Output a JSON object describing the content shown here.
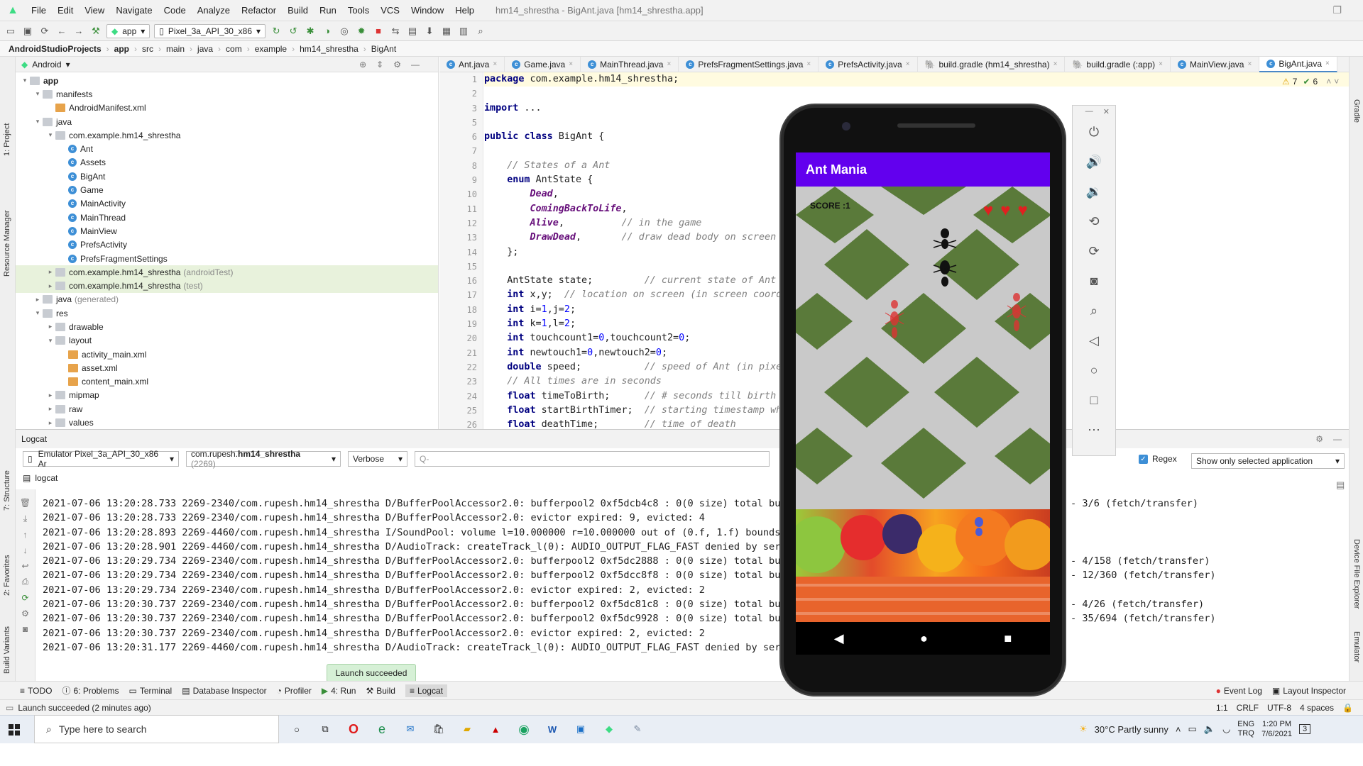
{
  "menu": {
    "items": [
      "File",
      "Edit",
      "View",
      "Navigate",
      "Code",
      "Analyze",
      "Refactor",
      "Build",
      "Run",
      "Tools",
      "VCS",
      "Window",
      "Help"
    ],
    "window_title": "hm14_shrestha - BigAnt.java [hm14_shrestha.app]"
  },
  "toolbar": {
    "run_config": "app",
    "device": "Pixel_3a_API_30_x86"
  },
  "breadcrumbs": [
    "AndroidStudioProjects",
    "app",
    "src",
    "main",
    "java",
    "com",
    "example",
    "hm14_shrestha",
    "BigAnt"
  ],
  "left_strip": {
    "project": "1: Project",
    "resource_manager": "Resource Manager",
    "structure": "7: Structure",
    "favorites": "2: Favorites",
    "build_variants": "Build Variants"
  },
  "project_panel": {
    "view_mode": "Android",
    "tree": [
      {
        "label": "app",
        "indent": 0,
        "arrow": "▾",
        "icon": "folder",
        "bold": true
      },
      {
        "label": "manifests",
        "indent": 1,
        "arrow": "▾",
        "icon": "folder"
      },
      {
        "label": "AndroidManifest.xml",
        "indent": 2,
        "arrow": "",
        "icon": "xml"
      },
      {
        "label": "java",
        "indent": 1,
        "arrow": "▾",
        "icon": "folder"
      },
      {
        "label": "com.example.hm14_shrestha",
        "indent": 2,
        "arrow": "▾",
        "icon": "folder"
      },
      {
        "label": "Ant",
        "indent": 3,
        "arrow": "",
        "icon": "class"
      },
      {
        "label": "Assets",
        "indent": 3,
        "arrow": "",
        "icon": "class"
      },
      {
        "label": "BigAnt",
        "indent": 3,
        "arrow": "",
        "icon": "class"
      },
      {
        "label": "Game",
        "indent": 3,
        "arrow": "",
        "icon": "class"
      },
      {
        "label": "MainActivity",
        "indent": 3,
        "arrow": "",
        "icon": "class"
      },
      {
        "label": "MainThread",
        "indent": 3,
        "arrow": "",
        "icon": "class"
      },
      {
        "label": "MainView",
        "indent": 3,
        "arrow": "",
        "icon": "class"
      },
      {
        "label": "PrefsActivity",
        "indent": 3,
        "arrow": "",
        "icon": "class"
      },
      {
        "label": "PrefsFragmentSettings",
        "indent": 3,
        "arrow": "",
        "icon": "class"
      },
      {
        "label": "com.example.hm14_shrestha",
        "suffix": "(androidTest)",
        "indent": 2,
        "arrow": "▸",
        "icon": "folder",
        "sel": true
      },
      {
        "label": "com.example.hm14_shrestha",
        "suffix": "(test)",
        "indent": 2,
        "arrow": "▸",
        "icon": "folder",
        "sel": true
      },
      {
        "label": "java",
        "suffix": "(generated)",
        "indent": 1,
        "arrow": "▸",
        "icon": "folder"
      },
      {
        "label": "res",
        "indent": 1,
        "arrow": "▾",
        "icon": "folder"
      },
      {
        "label": "drawable",
        "indent": 2,
        "arrow": "▸",
        "icon": "folder"
      },
      {
        "label": "layout",
        "indent": 2,
        "arrow": "▾",
        "icon": "folder"
      },
      {
        "label": "activity_main.xml",
        "indent": 3,
        "arrow": "",
        "icon": "xml"
      },
      {
        "label": "asset.xml",
        "indent": 3,
        "arrow": "",
        "icon": "xml"
      },
      {
        "label": "content_main.xml",
        "indent": 3,
        "arrow": "",
        "icon": "xml"
      },
      {
        "label": "mipmap",
        "indent": 2,
        "arrow": "▸",
        "icon": "folder"
      },
      {
        "label": "raw",
        "indent": 2,
        "arrow": "▸",
        "icon": "folder"
      },
      {
        "label": "values",
        "indent": 2,
        "arrow": "▸",
        "icon": "folder"
      }
    ]
  },
  "editor": {
    "tabs": [
      "Ant.java",
      "Game.java",
      "MainThread.java",
      "PrefsFragmentSettings.java",
      "PrefsActivity.java",
      "build.gradle (hm14_shrestha)",
      "build.gradle (:app)",
      "MainView.java",
      "BigAnt.java"
    ],
    "active_tab": "BigAnt.java",
    "warnings": "7",
    "checks": "6",
    "line_numbers": [
      "1",
      "2",
      "3",
      "5",
      "6",
      "7",
      "8",
      "9",
      "10",
      "11",
      "12",
      "13",
      "14",
      "15",
      "16",
      "17",
      "18",
      "19",
      "20",
      "21",
      "22",
      "23",
      "24",
      "25",
      "26"
    ],
    "lines": [
      "package com.example.hm14_shrestha;",
      "",
      "import ...",
      "",
      "public class BigAnt {",
      "",
      "    // States of a Ant",
      "    enum AntState {",
      "        Dead,",
      "        ComingBackToLife,",
      "        Alive,          // in the game",
      "        DrawDead,       // draw dead body on screen",
      "    };",
      "",
      "    AntState state;         // current state of Ant",
      "    int x,y;  // location on screen (in screen coordinates)",
      "    int i=1,j=2;",
      "    int k=1,l=2;",
      "    int touchcount1=0,touchcount2=0;",
      "    int newtouch1=0,newtouch2=0;",
      "    double speed;           // speed of Ant (in pixels)",
      "    // All times are in seconds",
      "    float timeToBirth;      // # seconds till birth",
      "    float startBirthTimer;  // starting timestamp when",
      "    float deathTime;        // time of death"
    ]
  },
  "logcat": {
    "title": "Logcat",
    "device": "Emulator Pixel_3a_API_30_x86 Ar",
    "process": "com.rupesh.",
    "process_bold": "hm14_shrestha",
    "pid": "(2269)",
    "level": "Verbose",
    "search_placeholder": "Q-",
    "regex_label": "Regex",
    "filter": "Show only selected application",
    "sub_title": "logcat",
    "lines": [
      "2021-07-06 13:20:28.733 2269-2340/com.rupesh.hm14_shrestha D/BufferPoolAccessor2.0: bufferpool2 0xf5dcb4c8 : 0(0 size) total buffe",
      "2021-07-06 13:20:28.733 2269-2340/com.rupesh.hm14_shrestha D/BufferPoolAccessor2.0: evictor expired: 9, evicted: 4",
      "2021-07-06 13:20:28.893 2269-4460/com.rupesh.hm14_shrestha I/SoundPool: volume l=10.000000 r=10.000000 out of (0.f, 1.f) bounds, u",
      "2021-07-06 13:20:28.901 2269-4460/com.rupesh.hm14_shrestha D/AudioTrack: createTrack_l(0): AUDIO_OUTPUT_FLAG_FAST denied by server",
      "2021-07-06 13:20:29.734 2269-2340/com.rupesh.hm14_shrestha D/BufferPoolAccessor2.0: bufferpool2 0xf5dc2888 : 0(0 size) total buffe",
      "2021-07-06 13:20:29.734 2269-2340/com.rupesh.hm14_shrestha D/BufferPoolAccessor2.0: bufferpool2 0xf5dcc8f8 : 0(0 size) total buffe",
      "2021-07-06 13:20:29.734 2269-2340/com.rupesh.hm14_shrestha D/BufferPoolAccessor2.0: evictor expired: 2, evicted: 2",
      "2021-07-06 13:20:30.737 2269-2340/com.rupesh.hm14_shrestha D/BufferPoolAccessor2.0: bufferpool2 0xf5dc81c8 : 0(0 size) total buffe",
      "2021-07-06 13:20:30.737 2269-2340/com.rupesh.hm14_shrestha D/BufferPoolAccessor2.0: bufferpool2 0xf5dc9928 : 0(0 size) total buffe",
      "2021-07-06 13:20:30.737 2269-2340/com.rupesh.hm14_shrestha D/BufferPoolAccessor2.0: evictor expired: 2, evicted: 2",
      "2021-07-06 13:20:31.177 2269-4460/com.rupesh.hm14_shrestha D/AudioTrack: createTrack_l(0): AUDIO_OUTPUT_FLAG_FAST denied by server"
    ],
    "tails": [
      "- 3/6 (fetch/transfer)",
      "",
      "",
      "",
      "- 4/158 (fetch/transfer)",
      "- 12/360 (fetch/transfer)",
      "",
      "- 4/26 (fetch/transfer)",
      "- 35/694 (fetch/transfer)",
      "",
      ""
    ]
  },
  "toast": "Launch succeeded",
  "bottom_tools": [
    "TODO",
    "6: Problems",
    "Terminal",
    "Database Inspector",
    "Profiler",
    "4: Run",
    "Build",
    "Logcat"
  ],
  "bottom_right": [
    "Event Log",
    "Layout Inspector"
  ],
  "status": {
    "message": "Launch succeeded (2 minutes ago)",
    "position": "1:1",
    "line_sep": "CRLF",
    "encoding": "UTF-8",
    "indent": "4 spaces"
  },
  "right_strip": {
    "gradle": "Gradle",
    "device_explorer": "Device File Explorer",
    "emulator": "Emulator"
  },
  "emulator": {
    "app_title": "Ant Mania",
    "score": "SCORE :1",
    "lives": 3
  },
  "taskbar": {
    "search_placeholder": "Type here to search",
    "weather": "30°C  Partly sunny",
    "lang1": "ENG",
    "lang2": "TRQ",
    "time": "1:20 PM",
    "date": "7/6/2021",
    "notifications": "3"
  }
}
